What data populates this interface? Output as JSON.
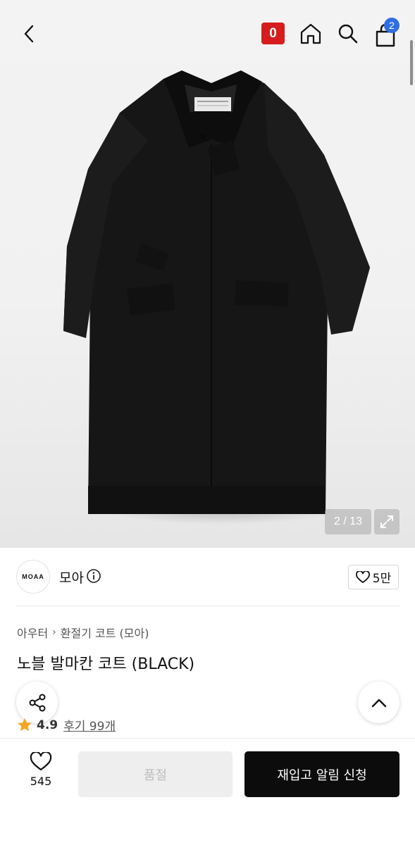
{
  "header": {
    "badge_label": "0",
    "cart_count": "2",
    "icons": [
      "chevron-left-icon",
      "home-icon",
      "search-icon",
      "shopping-bag-icon"
    ]
  },
  "gallery": {
    "counter": "2 / 13",
    "image": "black-coat-product-photo"
  },
  "brand": {
    "logo_text": "MOAA",
    "name": "모아",
    "likes": "5만"
  },
  "product": {
    "breadcrumb": [
      "아우터",
      "환절기 코트 (모아)"
    ],
    "title": "노블 발마칸 코트 (BLACK)",
    "rating": "4.9",
    "reviews": "후기 99개"
  },
  "bottom": {
    "wish_count": "545",
    "soldout_label": "품절",
    "restock_label": "재입고 알림 신청"
  },
  "colors": {
    "badge": "#d61c1c",
    "cart_badge": "#2f6ee5",
    "primary_button": "#0c0c0c",
    "disabled_button": "#eeeeee",
    "star": "#f5a623"
  }
}
